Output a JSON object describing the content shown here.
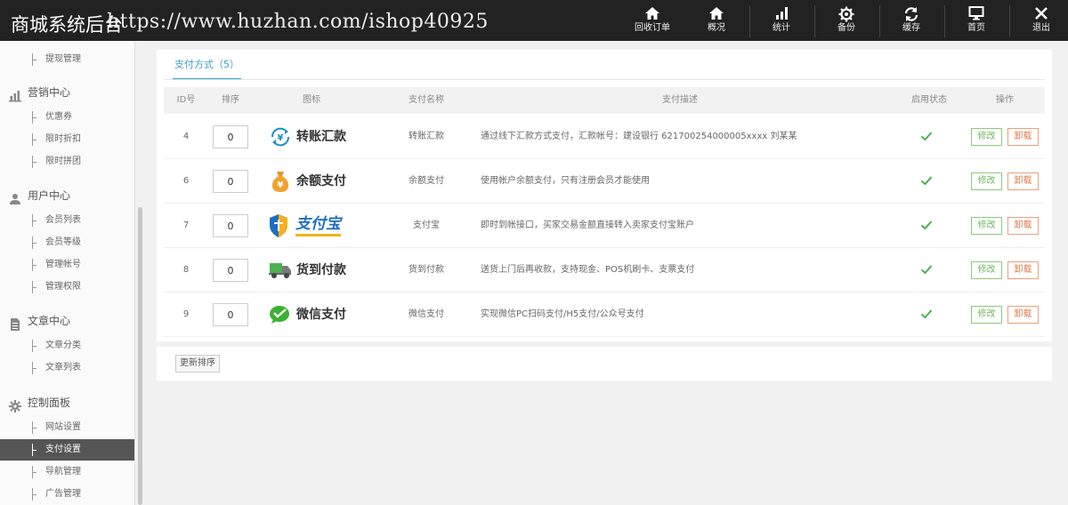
{
  "header": {
    "brand": "商城系统后台",
    "watermark": "https://www.huzhan.com/ishop40925",
    "nav": [
      {
        "label": "回收订单",
        "icon": "home-icon"
      },
      {
        "label": "概况",
        "icon": "home-icon"
      },
      {
        "label": "统计",
        "icon": "bar-chart-icon"
      },
      {
        "label": "备份",
        "icon": "gear-icon"
      },
      {
        "label": "缓存",
        "icon": "refresh-icon"
      },
      {
        "label": "首页",
        "icon": "monitor-icon"
      },
      {
        "label": "退出",
        "icon": "close-icon"
      }
    ]
  },
  "sidebar": {
    "items_top": [
      {
        "label": "提现管理"
      }
    ],
    "sections": [
      {
        "title": "营销中心",
        "icon": "bar-chart-icon",
        "items": [
          {
            "label": "优惠券"
          },
          {
            "label": "限时折扣"
          },
          {
            "label": "限时拼团"
          }
        ]
      },
      {
        "title": "用户中心",
        "icon": "user-icon",
        "items": [
          {
            "label": "会员列表"
          },
          {
            "label": "会员等级"
          },
          {
            "label": "管理帐号"
          },
          {
            "label": "管理权限"
          }
        ]
      },
      {
        "title": "文章中心",
        "icon": "document-icon",
        "items": [
          {
            "label": "文章分类"
          },
          {
            "label": "文章列表"
          }
        ]
      },
      {
        "title": "控制面板",
        "icon": "gear-icon",
        "items": [
          {
            "label": "网站设置"
          },
          {
            "label": "支付设置",
            "active": true
          },
          {
            "label": "导航管理"
          },
          {
            "label": "广告管理"
          }
        ]
      }
    ]
  },
  "main": {
    "tab_label": "支付方式（5）",
    "columns": {
      "id": "ID号",
      "sort": "排序",
      "icon": "图标",
      "name": "支付名称",
      "desc": "支付描述",
      "status": "启用状态",
      "ops": "操作"
    },
    "rows": [
      {
        "id": "4",
        "sort": "0",
        "logo_text": "转账汇款",
        "logo_icon": "bank-transfer-icon",
        "name": "转账汇款",
        "desc": "通过线下汇款方式支付，汇款帐号：建设银行 621700254000005xxxx 刘某某",
        "edit": "修改",
        "del": "卸载"
      },
      {
        "id": "6",
        "sort": "0",
        "logo_text": "余额支付",
        "logo_icon": "money-bag-icon",
        "name": "余额支付",
        "desc": "使用帐户余额支付，只有注册会员才能使用",
        "edit": "修改",
        "del": "卸载"
      },
      {
        "id": "7",
        "sort": "0",
        "logo_text": "支付宝",
        "logo_icon": "alipay-shield-icon",
        "name": "支付宝",
        "desc": "即时到帐接口，买家交易金额直接转入卖家支付宝账户",
        "edit": "修改",
        "del": "卸载"
      },
      {
        "id": "8",
        "sort": "0",
        "logo_text": "货到付款",
        "logo_icon": "truck-icon",
        "name": "货到付款",
        "desc": "送货上门后再收款，支持现金、POS机刷卡、支票支付",
        "edit": "修改",
        "del": "卸载"
      },
      {
        "id": "9",
        "sort": "0",
        "logo_text": "微信支付",
        "logo_icon": "wechat-icon",
        "name": "微信支付",
        "desc": "实现微信PC扫码支付/H5支付/公众号支付",
        "edit": "修改",
        "del": "卸载"
      }
    ],
    "update_sort_label": "更新排序"
  },
  "colors": {
    "topbar": "#222222",
    "accent": "#3aa1c7",
    "check": "#4caf50",
    "edit": "#6fb85c",
    "del": "#e07a48"
  }
}
